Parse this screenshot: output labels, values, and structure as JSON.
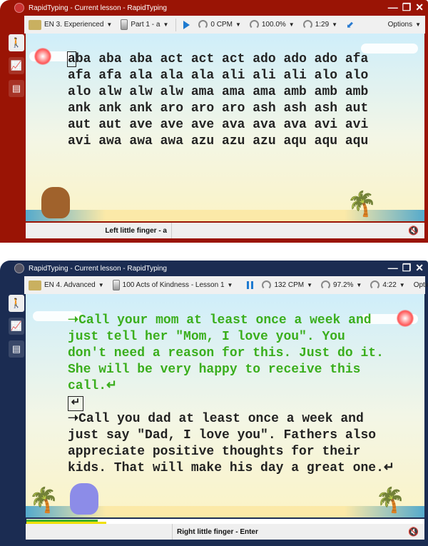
{
  "windows": [
    {
      "title": "RapidTyping - Current lesson - RapidTyping",
      "course": "EN 3. Experienced",
      "lesson": "Part 1 - a",
      "state": "play",
      "speed": "0 CPM",
      "accuracy": "100.0%",
      "time": "1:29",
      "options": "Options",
      "lines": [
        "aba aba aba act act act ado ado ado afa",
        "afa afa ala ala ala ali ali ali alo alo",
        "alo alw alw alw ama ama ama amb amb amb",
        "ank ank ank aro aro aro ash ash ash aut",
        "aut aut ave ave ave ava ava ava avi avi",
        "avi awa awa awa azu azu azu aqu aqu aqu"
      ],
      "status": "Left little finger - a",
      "theme": "#9a1405"
    },
    {
      "title": "RapidTyping - Current lesson - RapidTyping",
      "course": "EN 4. Advanced",
      "lesson": "100 Acts of Kindness - Lesson 1",
      "state": "pause",
      "speed": "132 CPM",
      "accuracy": "97.2%",
      "time": "4:22",
      "options": "Options",
      "typed": [
        "➝Call your mom at least once a week and",
        "just tell her \"Mom, I love you\". You",
        "don't need a reason for this. Just do it.",
        "She will be very happy to receive this",
        "call.↵"
      ],
      "pending": [
        "➝Call you dad at least once a week and",
        "just say \"Dad, I love you\". Fathers also",
        "appreciate positive thoughts for their",
        "kids. That will make his day a great one.↵"
      ],
      "enter_key": "↵",
      "progress_typed_pct": 18,
      "progress_time_pct": 20,
      "status": "Right little finger - Enter",
      "theme": "#1b2c52"
    }
  ],
  "icons": {
    "minimize": "—",
    "restore": "❐",
    "close": "✕",
    "side": [
      "walking-person-icon",
      "chart-icon",
      "pages-icon"
    ]
  }
}
